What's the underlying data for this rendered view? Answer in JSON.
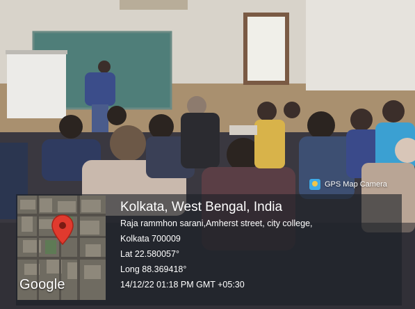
{
  "watermark": {
    "app_label": "GPS Map Camera",
    "app_icon": "camera-icon",
    "city": "Kolkata, West Bengal, India",
    "address_line1": "Raja rammhon sarani,Amherst street, city college,",
    "address_line2": "Kolkata 700009",
    "latitude": "Lat 22.580057°",
    "longitude": "Long 88.369418°",
    "timestamp": "14/12/22 01:18 PM GMT +05:30",
    "map_brand": "Google",
    "pin_icon": "map-pin-icon",
    "pin_color": "#e03a2e"
  }
}
